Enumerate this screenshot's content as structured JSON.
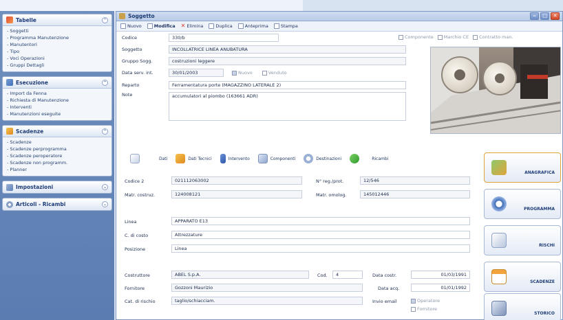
{
  "sidebar": {
    "groups": [
      {
        "title": "Tabelle",
        "items": [
          "- Soggetti",
          "- Programma Manutenzione",
          "- Manutentori",
          "- Tipo",
          "- Voci Operazioni",
          "- Gruppi Dettagli"
        ]
      },
      {
        "title": "Esecuzione",
        "items": [
          "- Import da Fenna",
          "- Richiesta di Manutenzione",
          "- Interventi",
          "- Manutenzioni eseguite"
        ]
      },
      {
        "title": "Scadenze",
        "items": [
          "- Scadenze",
          "- Scadenze perprogramma",
          "- Scadenze peroperatore",
          "- Scadenze non programm.",
          "- Planner"
        ]
      },
      {
        "title": "Impostazioni",
        "items": []
      },
      {
        "title": "Articoli - Ricambi",
        "items": []
      }
    ]
  },
  "window": {
    "title": "Soggetto",
    "controls": {
      "minimize": "‒",
      "maximize": "□",
      "close": "✕"
    }
  },
  "toolbar": {
    "nuovo": "Nuovo",
    "modifica": "Modifica",
    "elimina": "Elimina",
    "duplica": "Duplica",
    "anteprima": "Anteprima",
    "stampa": "Stampa"
  },
  "form": {
    "codice": {
      "label": "Codice",
      "value": "330/b"
    },
    "soggetto": {
      "label": "Soggetto",
      "value": "INCOLLATRICE LINEA ANUBATURA"
    },
    "gruppo": {
      "label": "Gruppo Sogg.",
      "value": "costruzioni leggere"
    },
    "data_serv": {
      "label": "Data serv. int.",
      "value": "30/01/2003"
    },
    "nuovo_cb": "Nuovo",
    "venduto_cb": "Venduto",
    "reparto": {
      "label": "Reparto",
      "value": "Ferramentatura porte (MAGAZZINO LATERALE 2)"
    },
    "note": {
      "label": "Note",
      "value": "accumulatori al piombo (163661 ADR)"
    },
    "componente_cb": "Componente",
    "marchio_cb": "Marchio CE",
    "contratto_cb": "Contratto man."
  },
  "tabs": [
    "Dati",
    "Dati Tecnici",
    "Intervento",
    "Componenti",
    "Destinazioni",
    "Ricambi"
  ],
  "lower": {
    "codice2": {
      "label": "Codice 2",
      "value": "021112063002"
    },
    "nreg": {
      "label": "N° reg./prot.",
      "value": "12/546"
    },
    "matr_costr": {
      "label": "Matr. costruz.",
      "value": "124008121"
    },
    "matr_omolog": {
      "label": "Matr. omolog.",
      "value": "145012446"
    },
    "linea": {
      "label": "Linea",
      "value": "APPARATO E13"
    },
    "cdc": {
      "label": "C. di costo",
      "value": "Attrezzature"
    },
    "posizione": {
      "label": "Posizione",
      "value": "Linea"
    },
    "costruttore": {
      "label": "Costruttore",
      "value": "ABEL S.p.A."
    },
    "cod": {
      "label": "Cod.",
      "value": "4"
    },
    "data_costr": {
      "label": "Data costr.",
      "value": "01/03/1991"
    },
    "fornitore": {
      "label": "Fornitore",
      "value": "Gozzoni Maurizio"
    },
    "data_acq": {
      "label": "Data acq.",
      "value": "01/01/1992"
    },
    "cat_rischio": {
      "label": "Cat. di rischio",
      "value": "taglio/schiacciam."
    },
    "invio_email": {
      "label": "Invio email",
      "operatore": "Operatore",
      "fornitore": "Fornitore"
    }
  },
  "bigbuttons": [
    "ANAGRAFICA",
    "PROGRAMMA",
    "RISCHI",
    "SCADENZE",
    "STORICO"
  ]
}
